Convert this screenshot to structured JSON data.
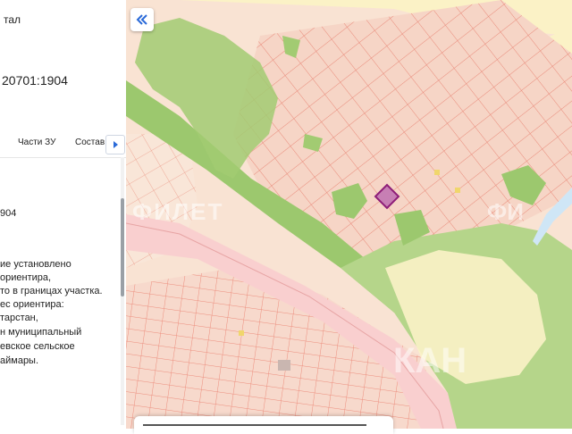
{
  "panel": {
    "title_fragment": "тал",
    "cadastral_fragment": "20701:1904",
    "number_fragment": "904",
    "desc_lines": [
      "ие установлено",
      "ориентира,",
      "то в границах участка.",
      "ес ориентира:",
      "тарстан,",
      "н муниципальный",
      "евское сельское",
      "аймары."
    ]
  },
  "tabs": [
    {
      "label": "Части ЗУ"
    },
    {
      "label": "Состав"
    }
  ],
  "map": {
    "collapse_icon": "double-chevron-left-icon",
    "watermark_left": "ФИЛЕТ",
    "watermark_right": "ФИ",
    "watermark_bottom": "КАН",
    "colors": {
      "parcel_fill": "#f6d5c6",
      "parcel_line": "#e98a7a",
      "forest": "#9cc86e",
      "road": "#f9cfcf",
      "river": "#cfe6f6",
      "field": "#fbf2c6",
      "selected_parcel": "#8e1e78"
    }
  }
}
